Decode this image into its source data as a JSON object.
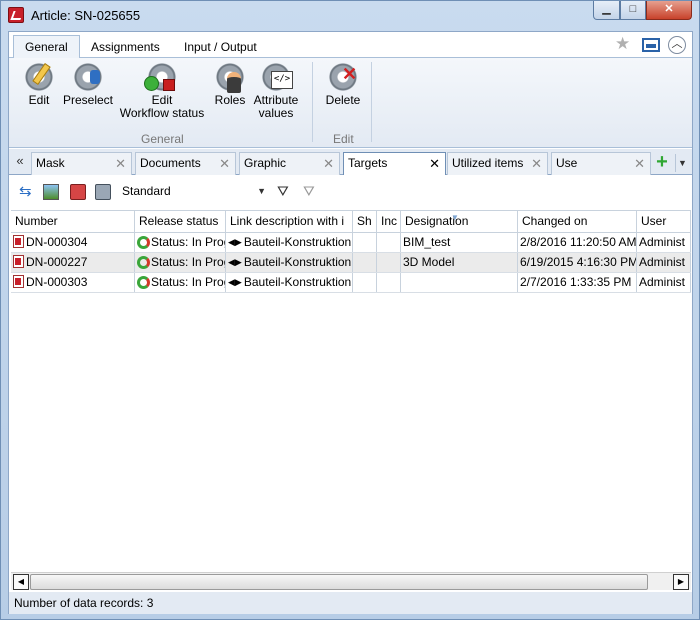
{
  "window": {
    "title": "Article: SN-025655",
    "minimize": "▁",
    "maximize": "□",
    "close": "✕"
  },
  "ribbon_tabs": [
    "General",
    "Assignments",
    "Input / Output"
  ],
  "ribbon": {
    "edit": "Edit",
    "preselect": "Preselect",
    "edit_workflow_1": "Edit",
    "edit_workflow_2": "Workflow status",
    "roles": "Roles",
    "attr_1": "Attribute",
    "attr_2": "values",
    "group_general": "General",
    "delete": "Delete",
    "group_edit": "Edit"
  },
  "doc_tabs": {
    "scroll_left": "«",
    "items": [
      "Mask",
      "Documents",
      "Graphic",
      "Targets",
      "Utilized items",
      "Use"
    ],
    "active": "Targets",
    "close": "✕",
    "add": "+",
    "menu": "▼"
  },
  "toolbar": {
    "view": "Standard",
    "dropdown_arrow": "▼",
    "filter": "⛛",
    "filter_clear": "⛛",
    "refresh": "⇆"
  },
  "grid": {
    "columns": [
      "Number",
      "Release status",
      "Link description with i",
      "Sh",
      "Inc",
      "Designation",
      "Changed on",
      "User"
    ],
    "rows": [
      {
        "number": "DN-000304",
        "status": "Status: In Prog",
        "link": "Bauteil-Konstruktion",
        "sh": "",
        "inc": "",
        "designation": "BIM_test",
        "changed": "2/8/2016 11:20:50 AM",
        "user": "Administ"
      },
      {
        "number": "DN-000227",
        "status": "Status: In Prog",
        "link": "Bauteil-Konstruktion",
        "sh": "",
        "inc": "",
        "designation": "3D Model",
        "changed": "6/19/2015 4:16:30 PM",
        "user": "Administ"
      },
      {
        "number": "DN-000303",
        "status": "Status: In Prog",
        "link": "Bauteil-Konstruktion",
        "sh": "",
        "inc": "",
        "designation": "",
        "changed": "2/7/2016 1:33:35 PM",
        "user": "Administ"
      }
    ]
  },
  "scroll": {
    "left": "◀",
    "right": "▶"
  },
  "status": {
    "records": "Number of data records: 3"
  }
}
